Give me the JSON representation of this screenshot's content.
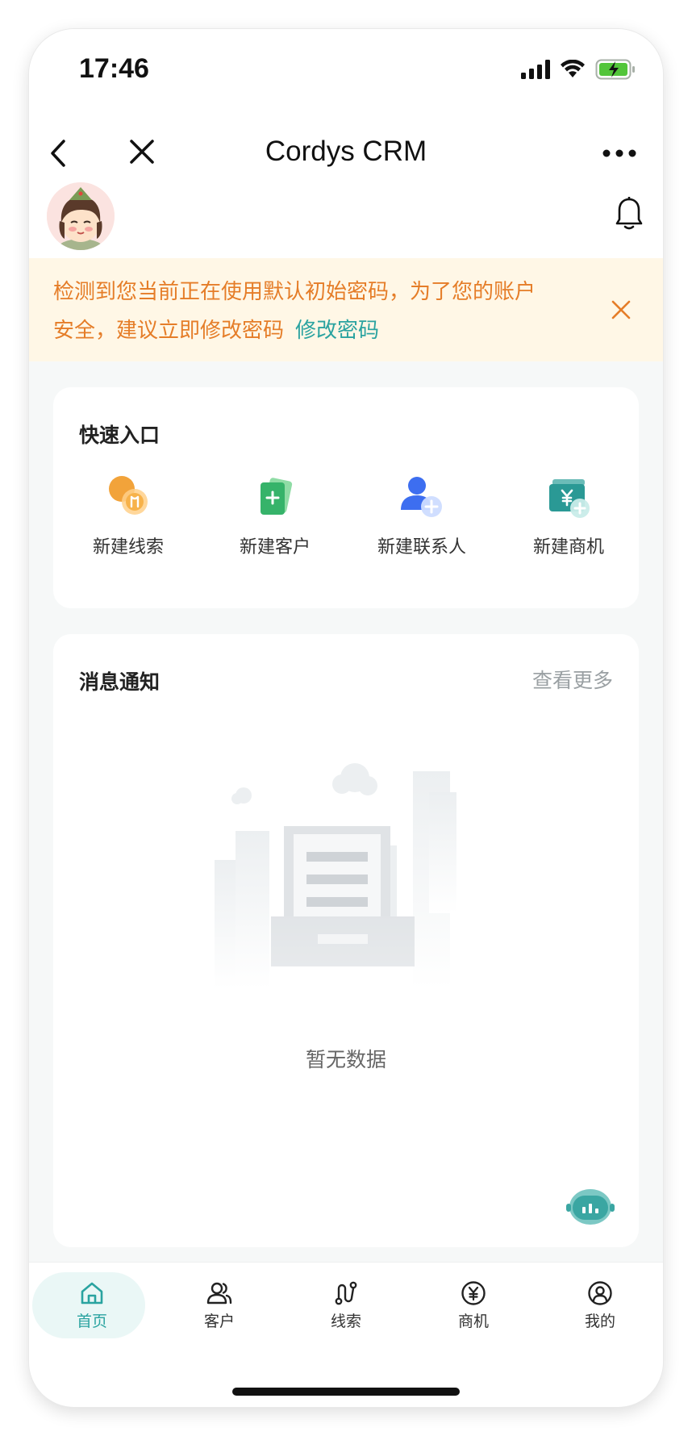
{
  "status_bar": {
    "time": "17:46"
  },
  "nav": {
    "title": "Cordys CRM"
  },
  "banner": {
    "message": "检测到您当前正在使用默认初始密码，为了您的账户安全，建议立即修改密码",
    "link_label": "修改密码"
  },
  "quick_entry": {
    "title": "快速入口",
    "items": [
      {
        "label": "新建线索",
        "icon": "lead-icon"
      },
      {
        "label": "新建客户",
        "icon": "customer-card-icon"
      },
      {
        "label": "新建联系人",
        "icon": "add-contact-icon"
      },
      {
        "label": "新建商机",
        "icon": "opportunity-yen-icon"
      }
    ]
  },
  "messages": {
    "title": "消息通知",
    "more_label": "查看更多",
    "empty_text": "暂无数据"
  },
  "tabs": [
    {
      "label": "首页",
      "icon": "home-icon",
      "active": true
    },
    {
      "label": "客户",
      "icon": "users-icon",
      "active": false
    },
    {
      "label": "线索",
      "icon": "route-icon",
      "active": false
    },
    {
      "label": "商机",
      "icon": "yen-circle-icon",
      "active": false
    },
    {
      "label": "我的",
      "icon": "user-circle-icon",
      "active": false
    }
  ],
  "colors": {
    "accent": "#2aa3a0",
    "warning_text": "#e57d28",
    "warning_bg": "#fff7e6"
  }
}
